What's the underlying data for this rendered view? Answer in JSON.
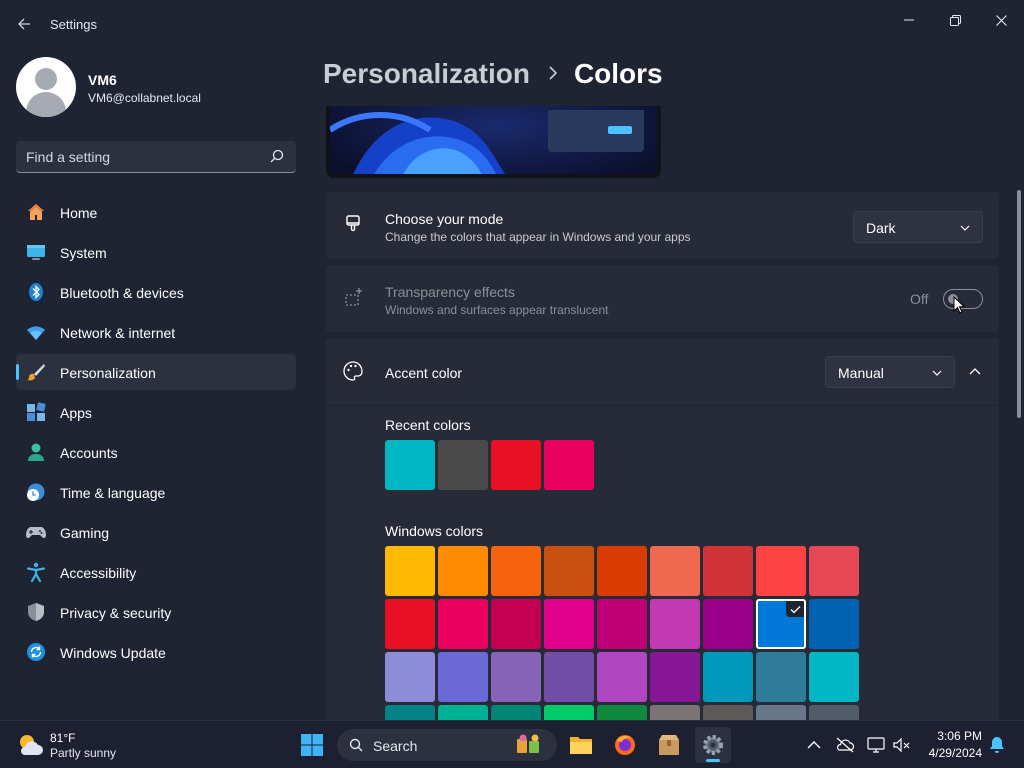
{
  "window": {
    "app_title": "Settings"
  },
  "profile": {
    "name": "VM6",
    "email": "VM6@collabnet.local"
  },
  "search": {
    "placeholder": "Find a setting"
  },
  "sidebar": {
    "items": [
      {
        "label": "Home",
        "icon": "home-icon"
      },
      {
        "label": "System",
        "icon": "system-icon"
      },
      {
        "label": "Bluetooth & devices",
        "icon": "bluetooth-icon"
      },
      {
        "label": "Network & internet",
        "icon": "wifi-icon"
      },
      {
        "label": "Personalization",
        "icon": "brush-icon",
        "active": true
      },
      {
        "label": "Apps",
        "icon": "apps-icon"
      },
      {
        "label": "Accounts",
        "icon": "accounts-icon"
      },
      {
        "label": "Time & language",
        "icon": "clock-globe-icon"
      },
      {
        "label": "Gaming",
        "icon": "gamepad-icon"
      },
      {
        "label": "Accessibility",
        "icon": "accessibility-icon"
      },
      {
        "label": "Privacy & security",
        "icon": "shield-icon"
      },
      {
        "label": "Windows Update",
        "icon": "update-icon"
      }
    ]
  },
  "header": {
    "parent": "Personalization",
    "current": "Colors"
  },
  "mode_card": {
    "title": "Choose your mode",
    "description": "Change the colors that appear in Windows and your apps",
    "value": "Dark"
  },
  "transparency_card": {
    "title": "Transparency effects",
    "description": "Windows and surfaces appear translucent",
    "state_label": "Off",
    "enabled": false
  },
  "accent_card": {
    "title": "Accent color",
    "value": "Manual",
    "recent_label": "Recent colors",
    "windows_label": "Windows colors",
    "recent_colors": [
      "#00b7c3",
      "#4a4a4a",
      "#e81123",
      "#ea005e"
    ],
    "windows_colors": [
      [
        "#ffb900",
        "#ff8c00",
        "#f7630c",
        "#ca5010",
        "#da3b01",
        "#ef6950",
        "#d13438",
        "#ff4343",
        "#e74856"
      ],
      [
        "#e81123",
        "#ea005e",
        "#c30052",
        "#e3008c",
        "#bf0077",
        "#c239b3",
        "#9a0089",
        "#0078d7",
        "#0063b1"
      ],
      [
        "#8e8cd8",
        "#6b69d6",
        "#8764b8",
        "#744da9",
        "#b146c2",
        "#881798",
        "#0099bc",
        "#2d7d9a",
        "#00b7c3"
      ],
      [
        "#038387",
        "#00b294",
        "#018574",
        "#00cc6a",
        "#10893e",
        "#7a7574",
        "#5d5a58",
        "#68768a",
        "#515c6b"
      ]
    ],
    "selected_color": "#0078d7"
  },
  "taskbar": {
    "weather_temp": "81°F",
    "weather_desc": "Partly sunny",
    "search_label": "Search",
    "time": "3:06 PM",
    "date": "4/29/2024"
  },
  "colors": {
    "accent": "#4cc2ff",
    "background": "#1f2433",
    "card": "#272b37"
  }
}
